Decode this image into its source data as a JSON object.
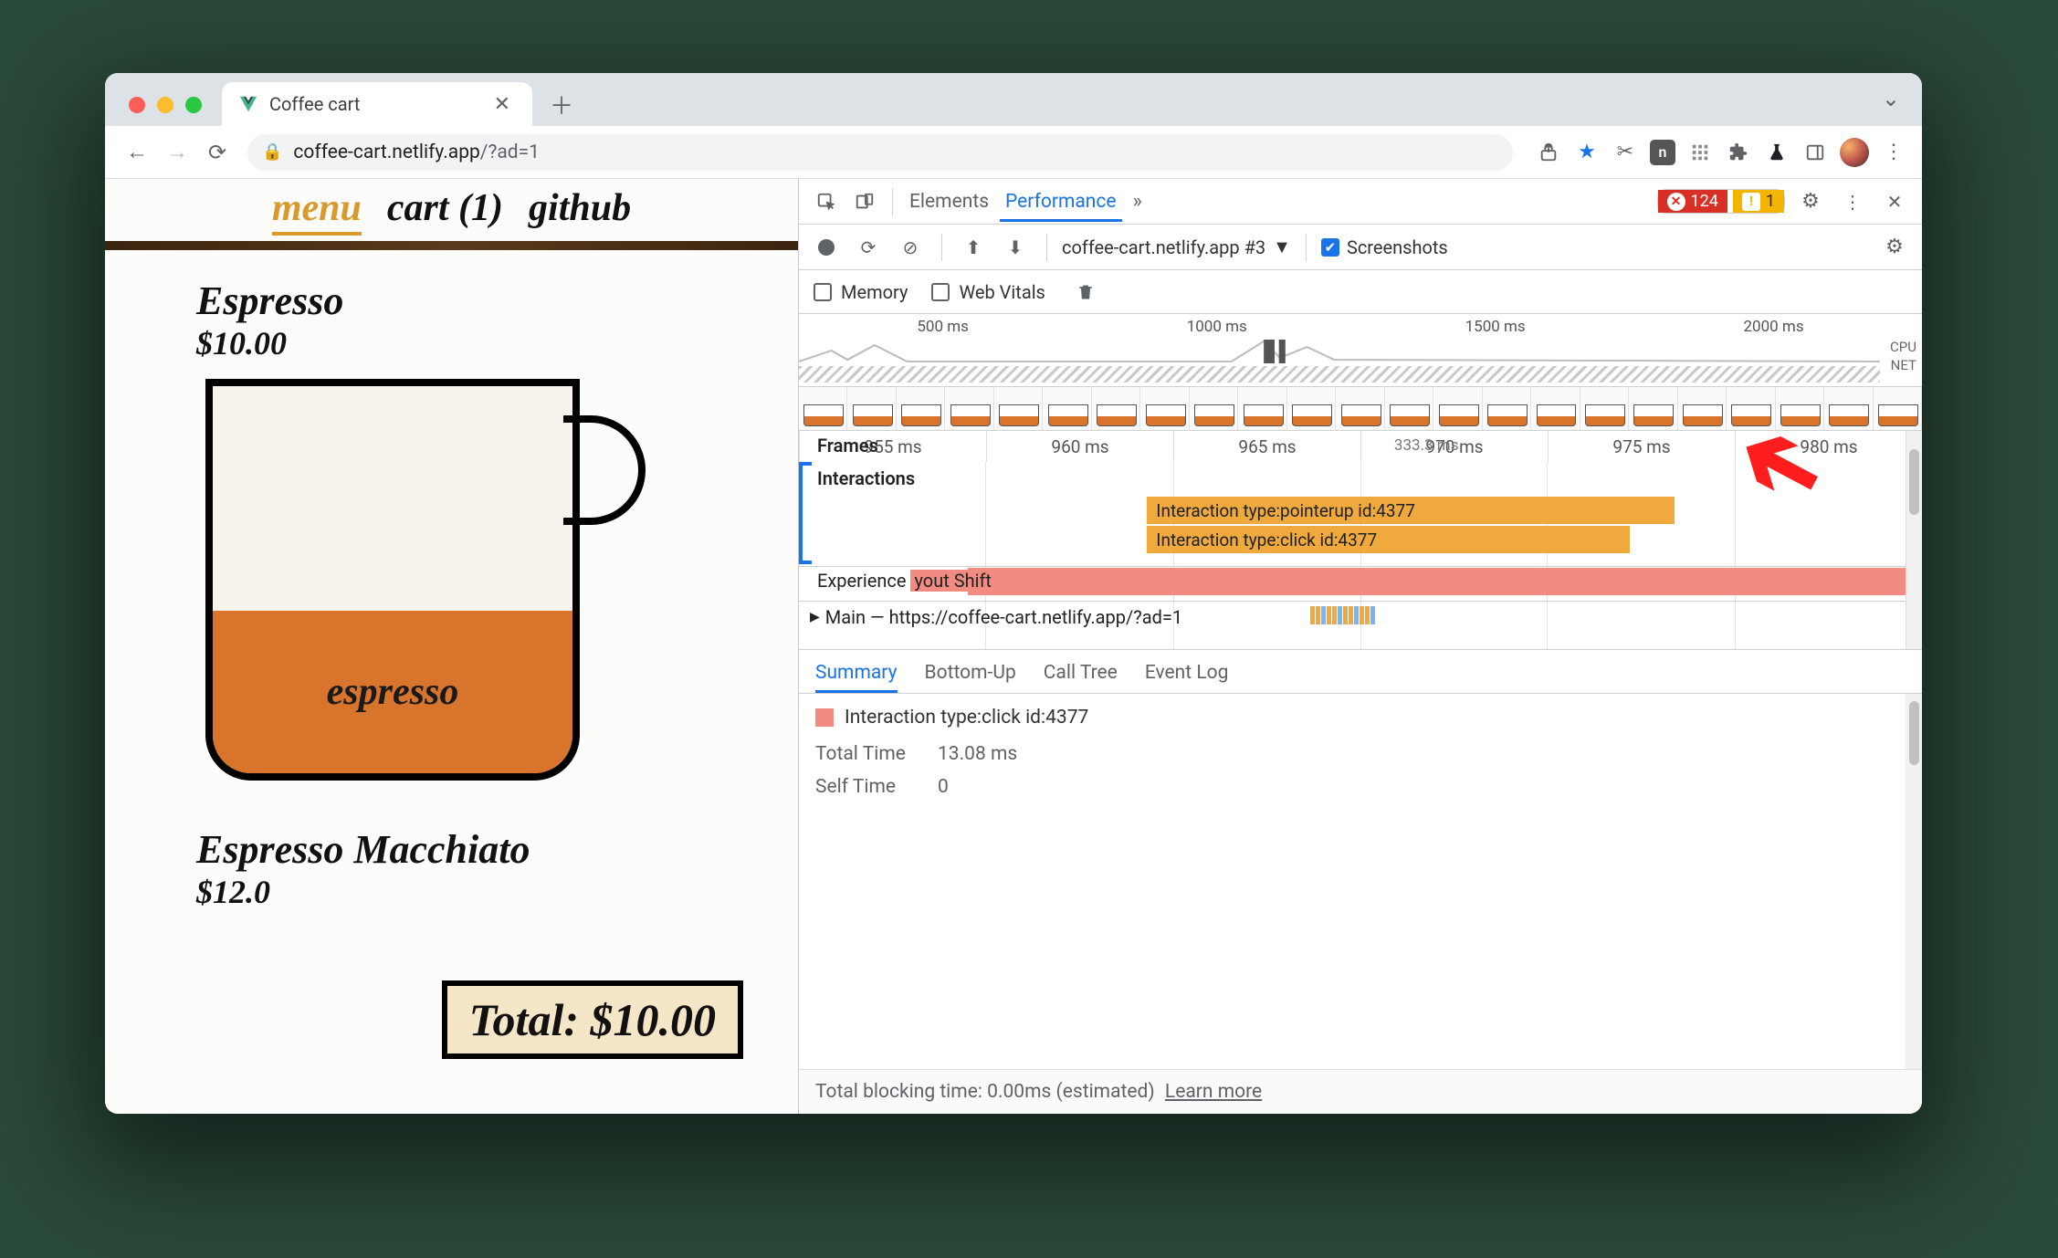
{
  "window": {
    "tab_title": "Coffee cart",
    "url_host": "coffee-cart.netlify.app",
    "url_path": "/?ad=1"
  },
  "page": {
    "nav": {
      "menu": "menu",
      "cart": "cart (1)",
      "github": "github"
    },
    "product1": {
      "name": "Espresso",
      "price": "$10.00",
      "fill_label": "espresso"
    },
    "product2": {
      "name": "Espresso Macchiato",
      "price": "$12.0"
    },
    "total_label": "Total: $10.00"
  },
  "devtools": {
    "tabs": {
      "elements": "Elements",
      "performance": "Performance"
    },
    "errors_count": "124",
    "warnings_count": "1",
    "recording_name": "coffee-cart.netlify.app #3",
    "screenshots_label": "Screenshots",
    "memory_label": "Memory",
    "webvitals_label": "Web Vitals",
    "overview_ticks": [
      "500 ms",
      "1000 ms",
      "1500 ms",
      "2000 ms"
    ],
    "overview_cpu": "CPU",
    "overview_net": "NET",
    "ruler_ticks": [
      "955 ms",
      "960 ms",
      "965 ms",
      "970 ms",
      "975 ms",
      "980 ms"
    ],
    "frames_label": "Frames",
    "fps_chip": "333.3 ms",
    "interactions_label": "Interactions",
    "bar_pointerup": "Interaction type:pointerup id:4377",
    "bar_click": "Interaction type:click id:4377",
    "experience_row_a": "Experience",
    "experience_row_b": "yout Shift",
    "main_row": "Main — https://coffee-cart.netlify.app/?ad=1",
    "summary_tabs": {
      "summary": "Summary",
      "bottom_up": "Bottom-Up",
      "call_tree": "Call Tree",
      "event_log": "Event Log"
    },
    "summary": {
      "title": "Interaction type:click id:4377",
      "total_time_k": "Total Time",
      "total_time_v": "13.08 ms",
      "self_time_k": "Self Time",
      "self_time_v": "0",
      "footer": "Total blocking time: 0.00ms (estimated)",
      "learn_more": "Learn more"
    }
  }
}
